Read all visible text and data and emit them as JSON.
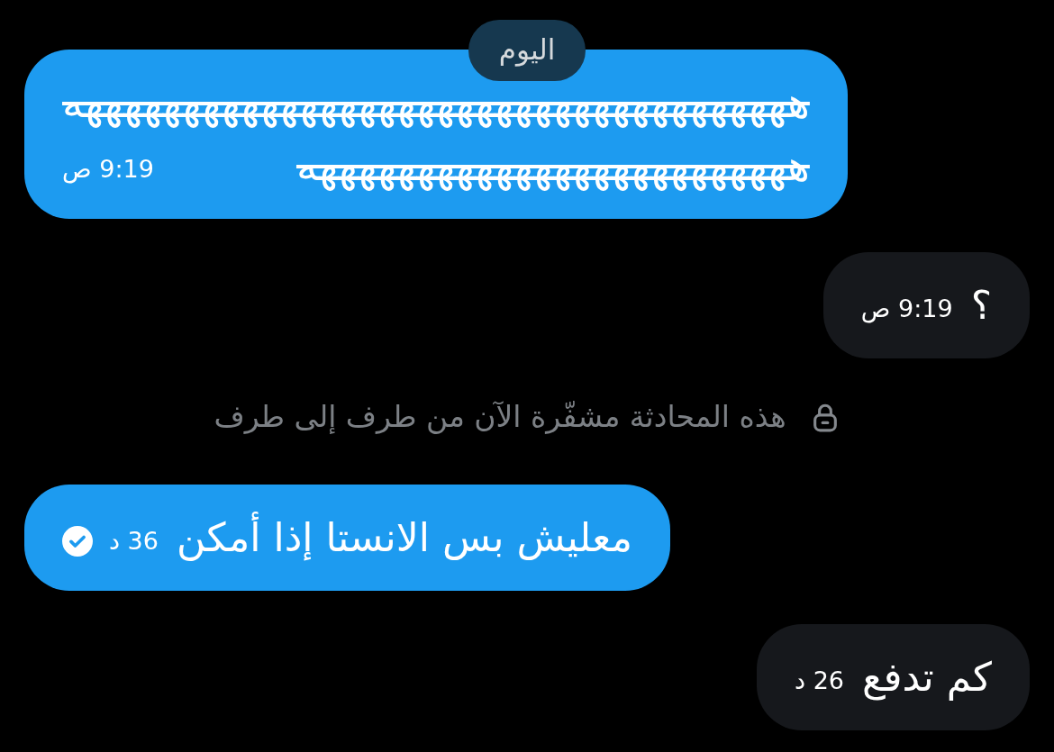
{
  "date_divider": {
    "label": "اليوم"
  },
  "messages": [
    {
      "kind": "outgoing",
      "text_lines": [
        "هههههههههههههههههههههههههههههههههههههه",
        "هههههههههههههههههههههههههه"
      ],
      "strikethrough": true,
      "time": "9:19 ص",
      "read": false
    },
    {
      "kind": "incoming",
      "text_lines": [
        "؟"
      ],
      "strikethrough": false,
      "time": "9:19 ص",
      "read": false
    },
    {
      "kind": "notice",
      "text": "هذه المحادثة مشفّرة الآن من طرف إلى طرف"
    },
    {
      "kind": "outgoing",
      "text_lines": [
        "معليش بس الانستا إذا أمكن"
      ],
      "strikethrough": false,
      "time": "36 د",
      "read": true
    },
    {
      "kind": "incoming",
      "text_lines": [
        "كم تدفع"
      ],
      "strikethrough": false,
      "time": "26 د",
      "read": false
    }
  ]
}
